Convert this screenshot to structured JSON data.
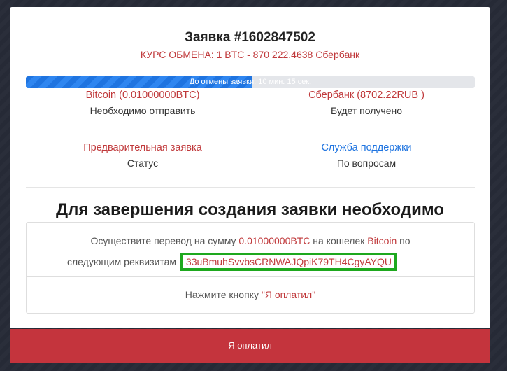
{
  "order": {
    "title": "Заявка #1602847502",
    "rate": "КУРС ОБМЕНА: 1 BTC - 870 222.4638 Сбербанк"
  },
  "timer": {
    "text": "До отмены заявки: 10 мин. 15 сек.",
    "progress_fraction": 0.505
  },
  "send": {
    "value": "Bitcoin (0.01000000BTC)",
    "label": "Необходимо отправить"
  },
  "receive": {
    "value": "Сбербанк (8702.22RUB )",
    "label": "Будет получено"
  },
  "status": {
    "value": "Предварительная заявка",
    "label": "Статус"
  },
  "support": {
    "value": "Служба поддержки",
    "label": "По вопросам"
  },
  "instructions": {
    "heading": "Для завершения создания заявки необходимо",
    "line1_prefix": "Осуществите перевод на сумму",
    "amount": "0.01000000BTC",
    "line1_mid": "на кошелек",
    "currency": "Bitcoin",
    "line1_suffix": "по",
    "line2_prefix": "следующим реквизитам",
    "wallet": "33uBmuhSvvbsCRNWAJQpiK79TH4CgyAYQU",
    "press_prefix": "Нажмите кнопку",
    "press_button_ref": "\"Я оплатил\""
  },
  "buttons": {
    "paid": "Я оплатил"
  },
  "colors": {
    "accent_red": "#c0393b",
    "button_red": "#c4343d",
    "link_blue": "#1f74e0",
    "highlight_green": "#1ea81e"
  }
}
